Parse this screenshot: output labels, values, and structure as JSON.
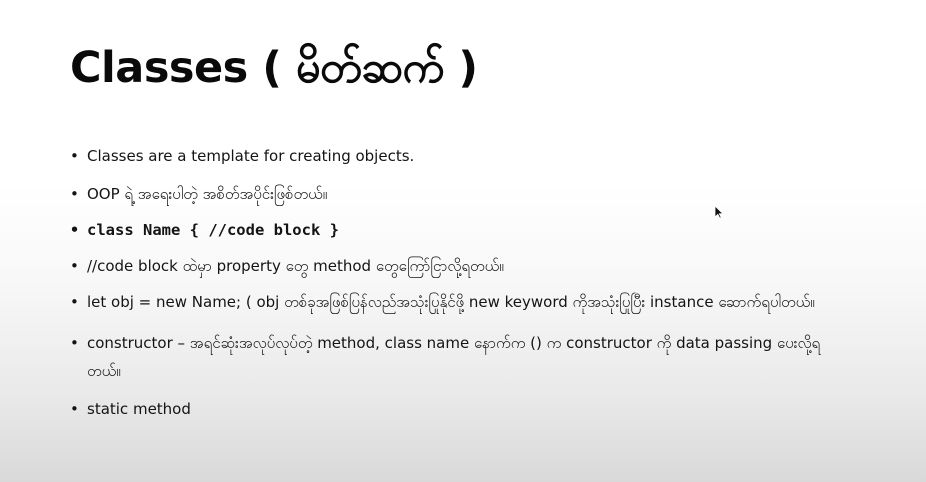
{
  "slide": {
    "title": "Classes ( မိတ်ဆက်  )",
    "bullets": [
      "Classes are a template for creating objects.",
      "OOP ရဲ့ အရေးပါတဲ့ အစိတ်အပိုင်းဖြစ်တယ်။",
      "class Name { //code block }",
      "//code block ထဲမှာ property တွေ method တွေကြော်ငြာလို့ရတယ်။",
      "let obj = new Name; ( obj တစ်ခုအဖြစ်ပြန်လည်အသုံးပြုနိုင်ဖို့ new keyword ကိုအသုံးပြုပြီး instance ဆောက်ရပါတယ်။",
      "constructor – အရင်ဆုံးအလုပ်လုပ်တဲ့ method, class name နောက်က () က constructor ကို data passing ပေးလို့ရတယ်။",
      "static method"
    ],
    "bullet_symbol": "•"
  },
  "cursor": {
    "icon": "mouse-pointer-icon"
  }
}
